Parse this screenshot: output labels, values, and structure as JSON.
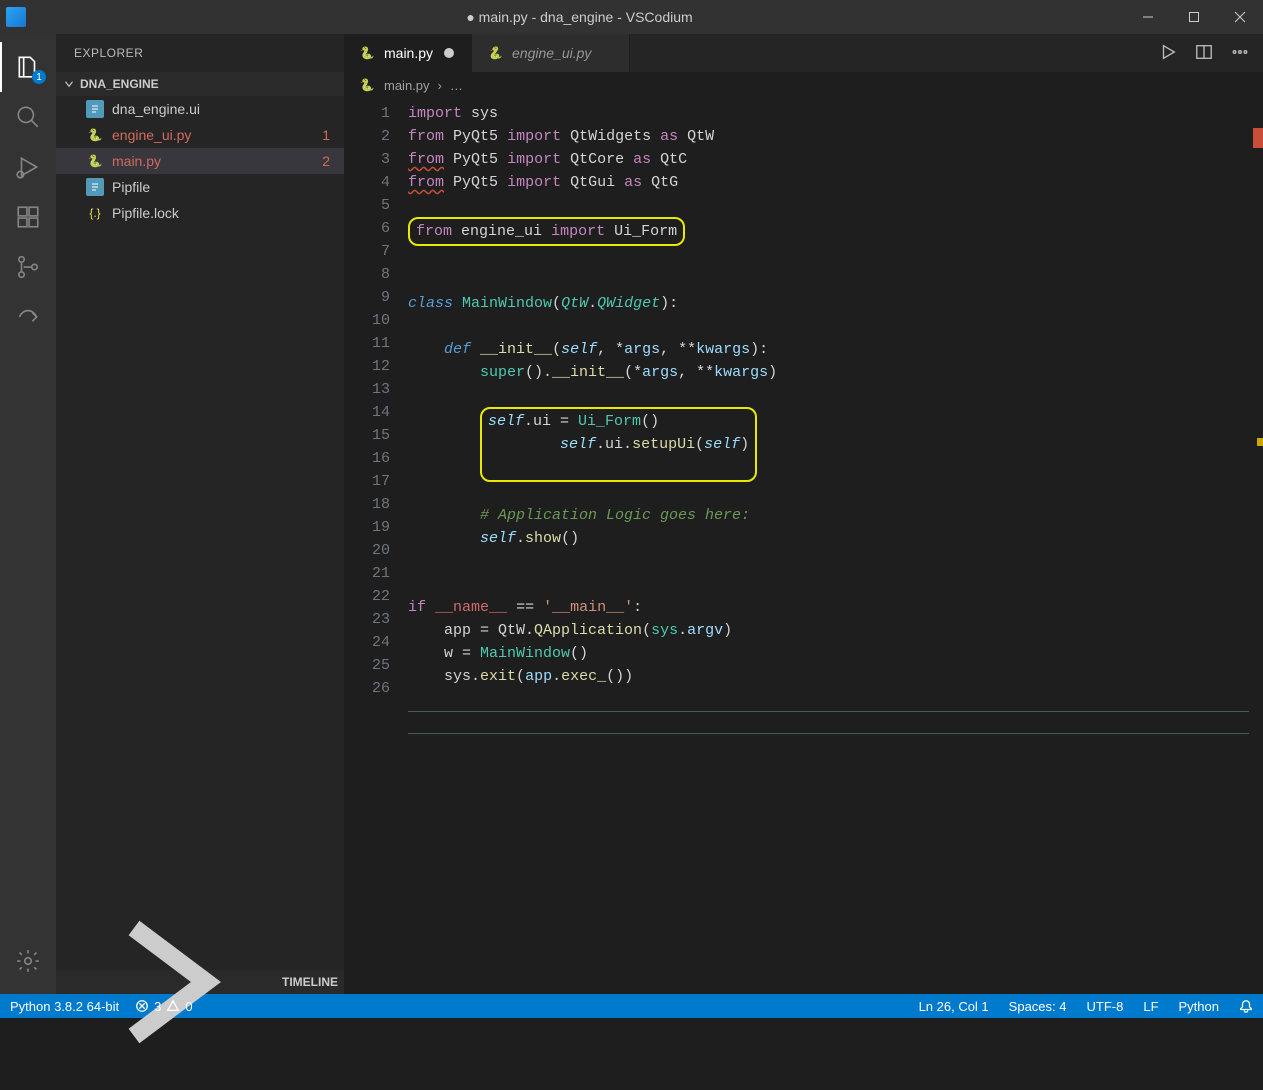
{
  "title": "● main.py - dna_engine - VSCodium",
  "explorer": "EXPLORER",
  "project": "DNA_ENGINE",
  "timeline": "TIMELINE",
  "badge": "1",
  "files": [
    {
      "name": "dna_engine.ui",
      "icon": "blue",
      "err": "",
      "sel": false
    },
    {
      "name": "engine_ui.py",
      "icon": "py",
      "err": "1",
      "sel": false
    },
    {
      "name": "main.py",
      "icon": "py",
      "err": "2",
      "sel": true
    },
    {
      "name": "Pipfile",
      "icon": "blue",
      "err": "",
      "sel": false
    },
    {
      "name": "Pipfile.lock",
      "icon": "json",
      "err": "",
      "sel": false
    }
  ],
  "tabs": [
    {
      "name": "main.py",
      "active": true,
      "dirty": true
    },
    {
      "name": "engine_ui.py",
      "active": false,
      "dirty": false
    }
  ],
  "breadcrumb": {
    "file": "main.py",
    "more": "…"
  },
  "status": {
    "python": "Python 3.8.2 64-bit",
    "errors": "3",
    "warnings": "0",
    "pos": "Ln 26, Col 1",
    "spaces": "Spaces: 4",
    "enc": "UTF-8",
    "eol": "LF",
    "lang": "Python"
  },
  "code_lines": 26
}
